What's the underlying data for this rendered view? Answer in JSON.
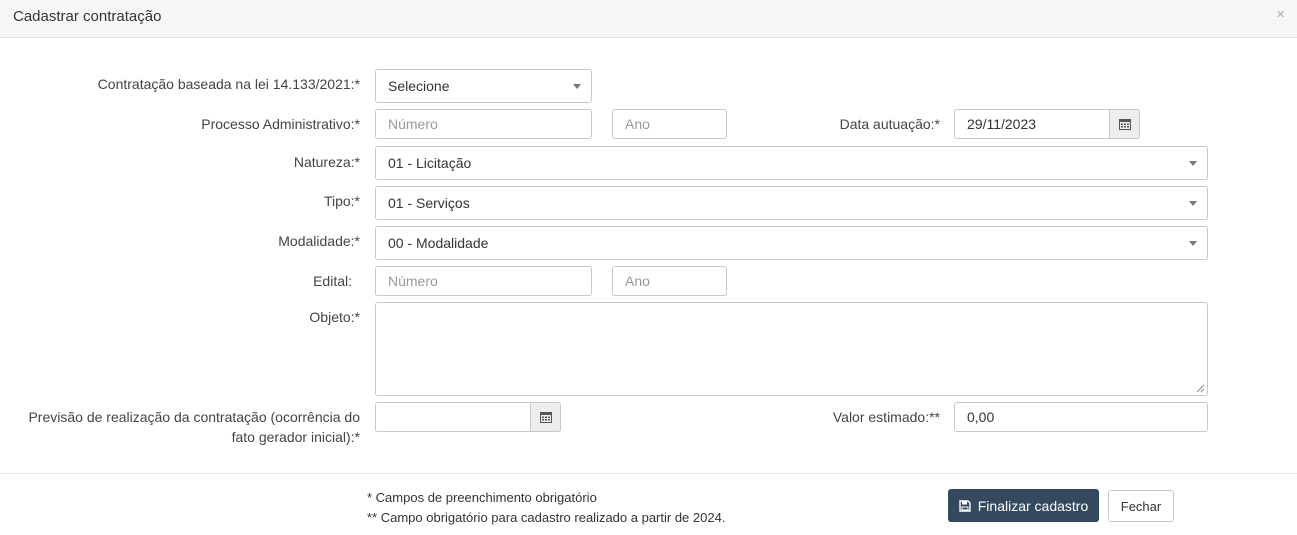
{
  "modal": {
    "title": "Cadastrar contratação",
    "close_glyph": "×"
  },
  "form": {
    "lei": {
      "label": "Contratação baseada na lei 14.133/2021:*",
      "value": "Selecione"
    },
    "processo": {
      "label": "Processo Administrativo:*",
      "numero_placeholder": "Número",
      "ano_placeholder": "Ano",
      "data_label": "Data autuação:*",
      "data_value": "29/11/2023"
    },
    "natureza": {
      "label": "Natureza:*",
      "value": "01 - Licitação"
    },
    "tipo": {
      "label": "Tipo:*",
      "value": "01 - Serviços"
    },
    "modalidade": {
      "label": "Modalidade:*",
      "value": "00 - Modalidade"
    },
    "edital": {
      "label": "Edital:",
      "numero_placeholder": "Número",
      "ano_placeholder": "Ano"
    },
    "objeto": {
      "label": "Objeto:*",
      "value": ""
    },
    "previsao": {
      "label_line1": "Previsão de realização da contratação (ocorrência do",
      "label_line2": "fato gerador inicial):*",
      "value": ""
    },
    "valor": {
      "label": "Valor estimado:**",
      "value": "0,00"
    }
  },
  "footer": {
    "note1": "* Campos de preenchimento obrigatório",
    "note2": "** Campo obrigatório para cadastro realizado a partir de 2024.",
    "finalizar_label": "Finalizar cadastro",
    "fechar_label": "Fechar"
  },
  "icons": {
    "calendar": "calendar-icon",
    "save": "save-icon",
    "caret": "chevron-down-icon"
  },
  "colors": {
    "primary_button": "#34495e",
    "header_bg": "#f7f7f7",
    "border": "#c8c8c8"
  }
}
